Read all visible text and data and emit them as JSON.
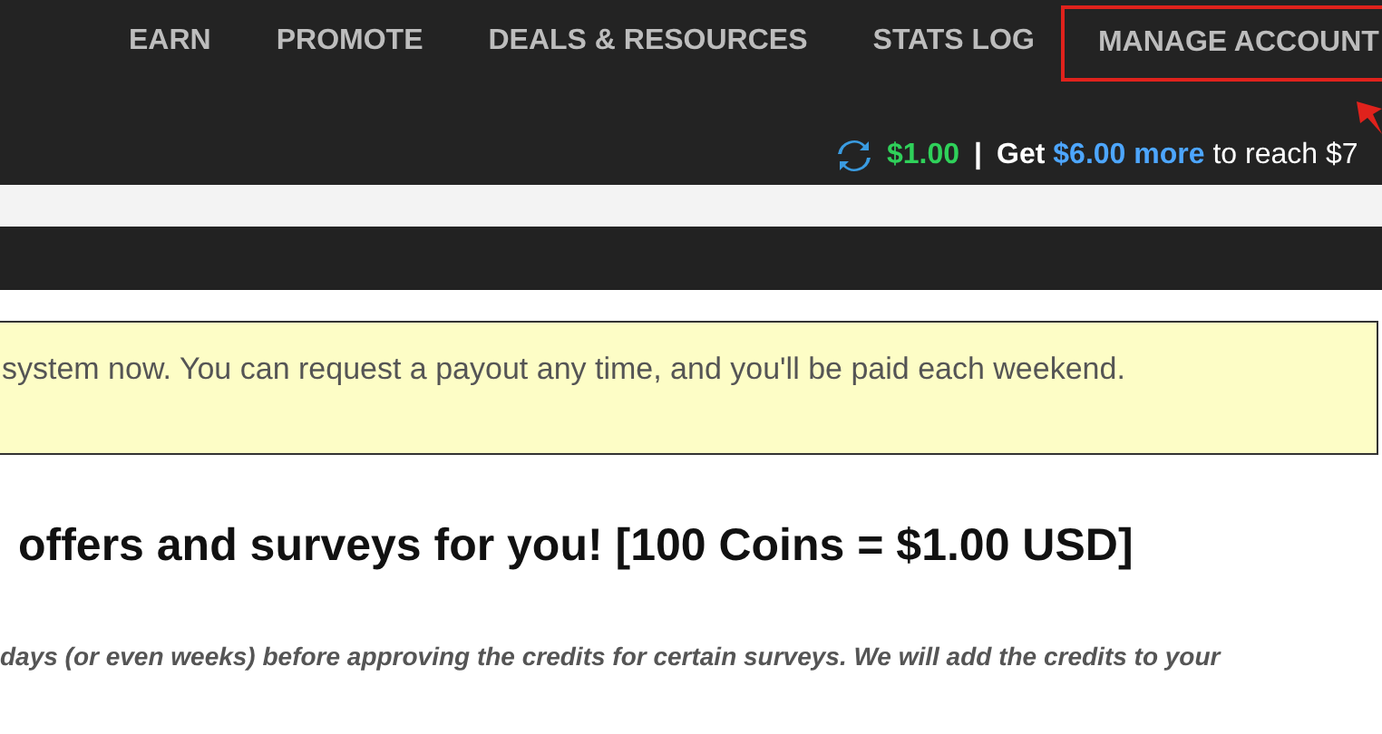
{
  "nav": {
    "items": [
      {
        "label": "EARN",
        "highlighted": false
      },
      {
        "label": "PROMOTE",
        "highlighted": false
      },
      {
        "label": "DEALS & RESOURCES",
        "highlighted": false
      },
      {
        "label": "STATS LOG",
        "highlighted": false
      },
      {
        "label": "MANAGE ACCOUNT",
        "highlighted": true
      }
    ]
  },
  "balance": {
    "amount": "$1.00",
    "separator": "|",
    "text_before": "Get",
    "link": "$6.00 more",
    "text_after": "to reach $7"
  },
  "notice": {
    "text": "system now. You can request a payout any time, and you'll be paid each weekend."
  },
  "heading": "offers and surveys for you! [100 Coins = $1.00 USD]",
  "note": "days (or even weeks) before approving the credits for certain surveys. We will add the credits to your"
}
